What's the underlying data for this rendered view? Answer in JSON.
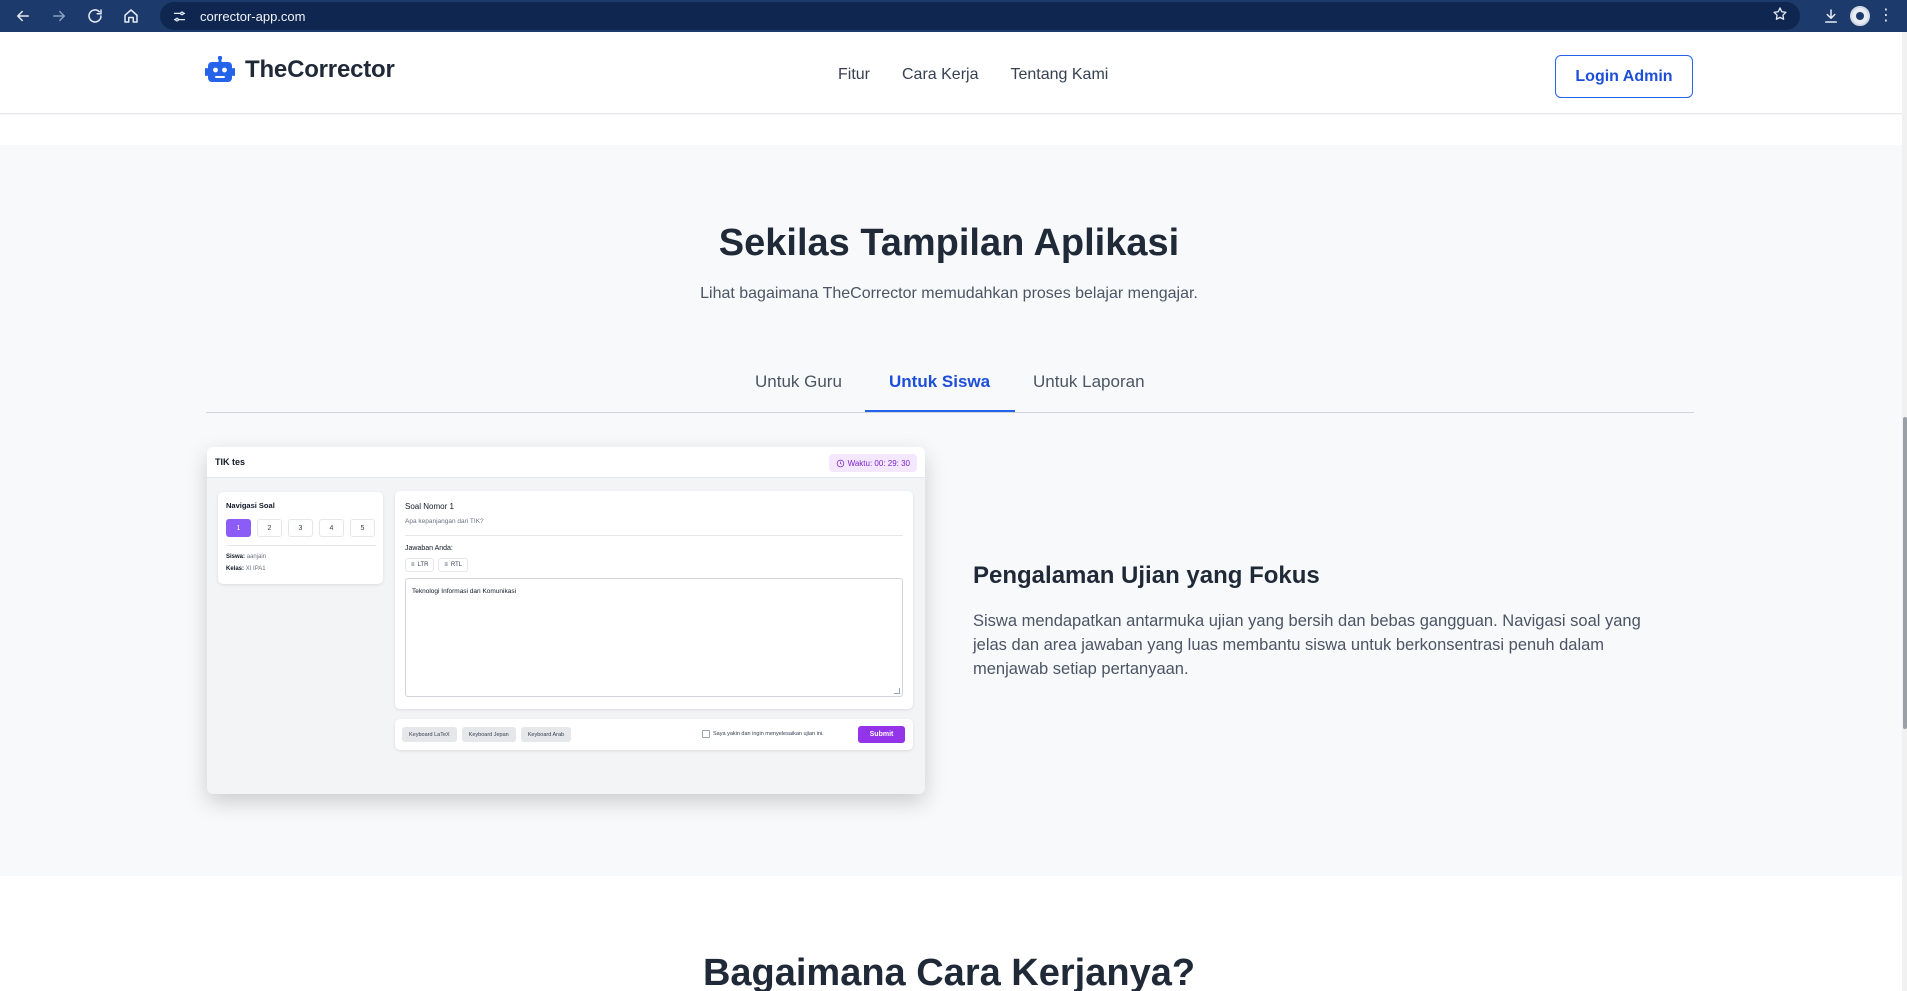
{
  "browser": {
    "url": "corrector-app.com",
    "icons": [
      "back-icon",
      "forward-icon",
      "reload-icon",
      "home-icon",
      "site-settings-icon",
      "bookmark-star-icon",
      "download-icon",
      "profile-avatar",
      "menu-kebab-icon"
    ]
  },
  "header": {
    "logo_text": "TheCorrector",
    "nav": [
      "Fitur",
      "Cara Kerja",
      "Tentang Kami"
    ],
    "login_label": "Login Admin"
  },
  "section": {
    "title": "Sekilas Tampilan Aplikasi",
    "subtitle": "Lihat bagaimana TheCorrector memudahkan proses belajar mengajar.",
    "tabs": [
      "Untuk Guru",
      "Untuk Siswa",
      "Untuk Laporan"
    ],
    "active_tab": "Untuk Siswa"
  },
  "mock": {
    "title": "TIK tes",
    "timer": "Waktu: 00: 29: 30",
    "nav_title": "Navigasi Soal",
    "questions": [
      "1",
      "2",
      "3",
      "4",
      "5"
    ],
    "student_label": "Siswa:",
    "student_value": "aanjain",
    "class_label": "Kelas:",
    "class_value": "XI IPA1",
    "question_title": "Soal Nomor 1",
    "question_text": "Apa kepanjangan dari TIK?",
    "answer_label": "Jawaban Anda:",
    "ltr": "LTR",
    "rtl": "RTL",
    "answer_value": "Teknologi Informasi dan Komunikasi",
    "keyboards": [
      "Keyboard LaTeX",
      "Keyboard Jepan",
      "Keyboard Arab"
    ],
    "confirm_text": "Saya yakin dan ingin menyelesaikan ujian ini.",
    "submit_label": "Submit"
  },
  "feature": {
    "title": "Pengalaman Ujian yang Fokus",
    "description": "Siswa mendapatkan antarmuka ujian yang bersih dan bebas gangguan. Navigasi soal yang jelas dan area jawaban yang luas membantu siswa untuk berkonsentrasi penuh dalam menjawab setiap pertanyaan."
  },
  "next_section": {
    "title": "Bagaimana Cara Kerjanya?"
  },
  "colors": {
    "brand_blue": "#2563eb",
    "purple": "#9333ea",
    "chrome": "#1c3a6b"
  }
}
